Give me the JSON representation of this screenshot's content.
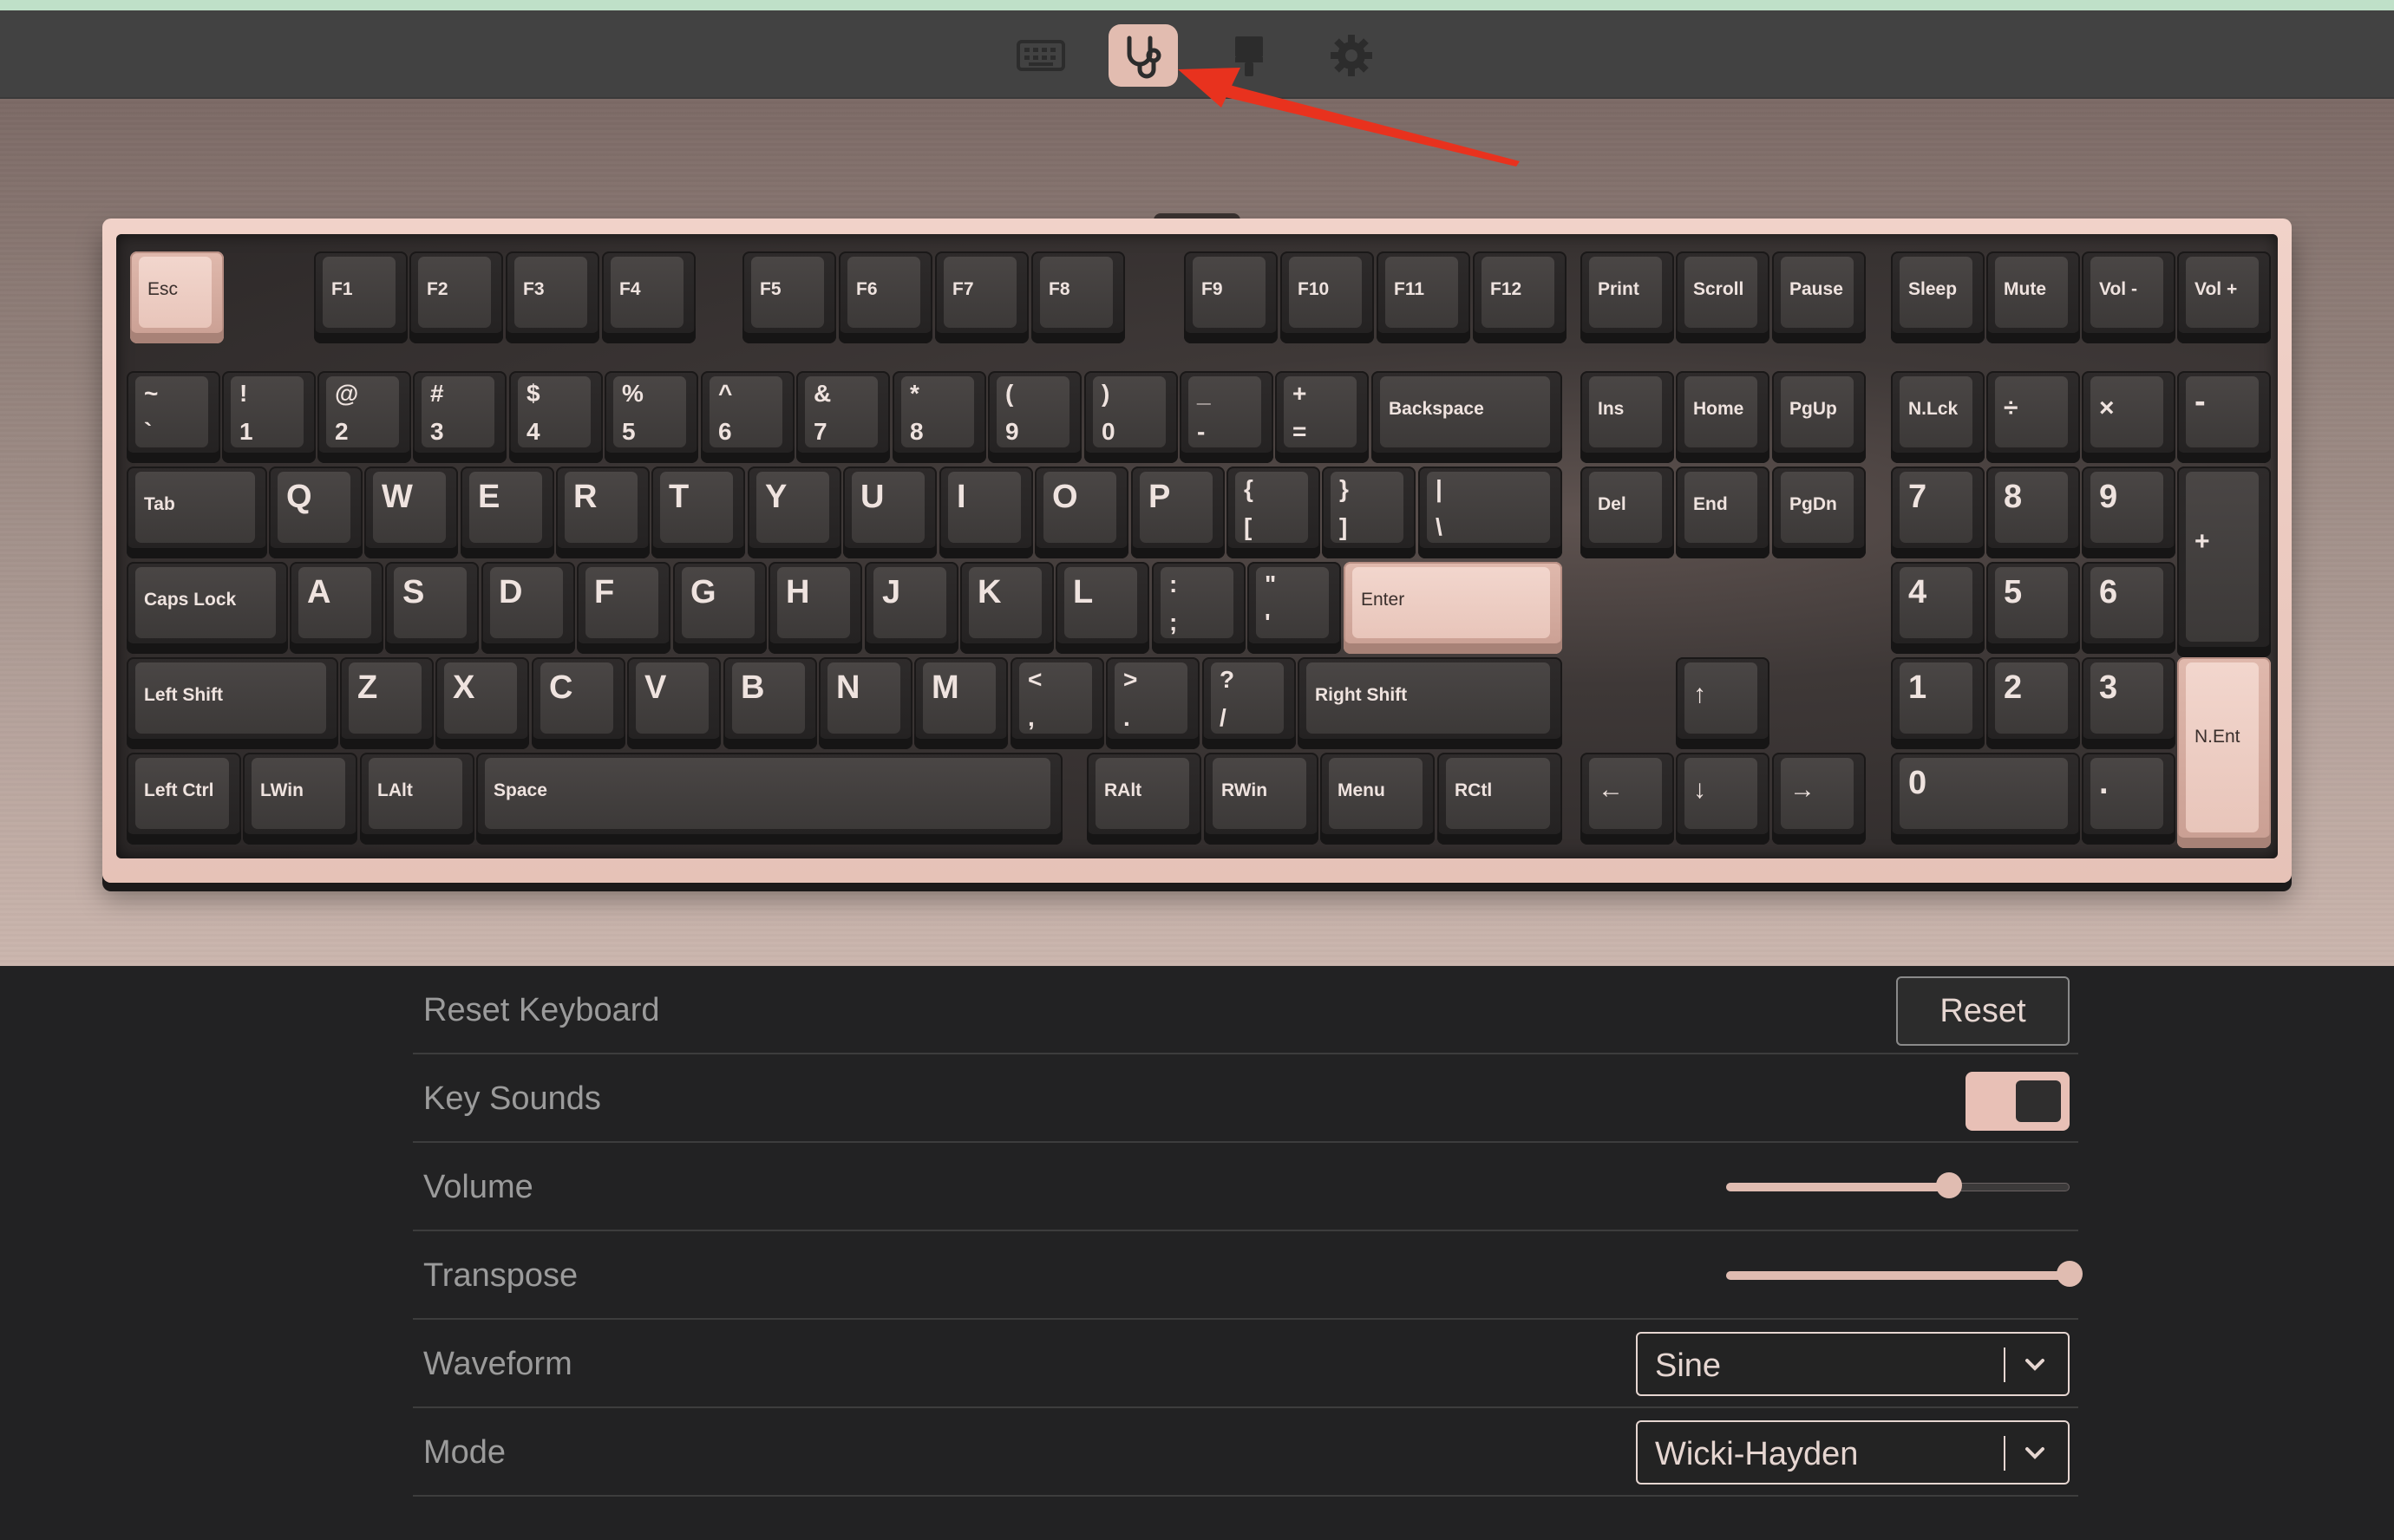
{
  "tabs": [
    {
      "name": "keyboard",
      "icon": "keyboard-icon",
      "active": false
    },
    {
      "name": "test",
      "icon": "stethoscope-icon",
      "active": true
    },
    {
      "name": "theme",
      "icon": "paint-brush-icon",
      "active": false
    },
    {
      "name": "settings",
      "icon": "gear-icon",
      "active": false
    }
  ],
  "keyboard": {
    "accent_color": "#e2bcb0",
    "rows": {
      "function": [
        "Esc",
        "F1",
        "F2",
        "F3",
        "F4",
        "F5",
        "F6",
        "F7",
        "F8",
        "F9",
        "F10",
        "F11",
        "F12",
        "Print",
        "Scroll",
        "Pause",
        "Sleep",
        "Mute",
        "Vol -",
        "Vol +"
      ],
      "number": [
        [
          "~",
          "`"
        ],
        [
          "!",
          "1"
        ],
        [
          "@",
          "2"
        ],
        [
          "#",
          "3"
        ],
        [
          "$",
          "4"
        ],
        [
          "%",
          "5"
        ],
        [
          "^",
          "6"
        ],
        [
          "&",
          "7"
        ],
        [
          "*",
          "8"
        ],
        [
          "(",
          "9"
        ],
        [
          ")",
          "0"
        ],
        [
          "_",
          "-"
        ],
        [
          "+",
          "="
        ],
        "Backspace",
        "Ins",
        "Home",
        "PgUp",
        "N.Lck",
        "÷",
        "×",
        "-"
      ],
      "top": [
        "Tab",
        "Q",
        "W",
        "E",
        "R",
        "T",
        "Y",
        "U",
        "I",
        "O",
        "P",
        [
          "{",
          "["
        ],
        [
          "}",
          "]"
        ],
        [
          "|",
          "\\"
        ],
        "Del",
        "End",
        "PgDn",
        "7",
        "8",
        "9",
        "+"
      ],
      "home": [
        "Caps Lock",
        "A",
        "S",
        "D",
        "F",
        "G",
        "H",
        "J",
        "K",
        "L",
        [
          ":",
          ";"
        ],
        [
          "\"",
          "'"
        ],
        "Enter",
        "4",
        "5",
        "6"
      ],
      "shift": [
        "Left Shift",
        "Z",
        "X",
        "C",
        "V",
        "B",
        "N",
        "M",
        [
          "<",
          ","
        ],
        [
          ">",
          "."
        ],
        [
          "?",
          "/"
        ],
        "Right Shift",
        "↑",
        "1",
        "2",
        "3",
        "N.Ent"
      ],
      "bottom": [
        "Left Ctrl",
        "LWin",
        "LAlt",
        "Space",
        "RAlt",
        "RWin",
        "Menu",
        "RCtl",
        "←",
        "↓",
        "→",
        "0",
        "."
      ]
    }
  },
  "settings": {
    "reset_keyboard": {
      "label": "Reset Keyboard",
      "button": "Reset"
    },
    "key_sounds": {
      "label": "Key Sounds",
      "enabled": true
    },
    "volume": {
      "label": "Volume",
      "value": 0.65
    },
    "transpose": {
      "label": "Transpose",
      "value": 1.0
    },
    "waveform": {
      "label": "Waveform",
      "selected": "Sine"
    },
    "mode": {
      "label": "Mode",
      "selected": "Wicki-Hayden"
    }
  }
}
